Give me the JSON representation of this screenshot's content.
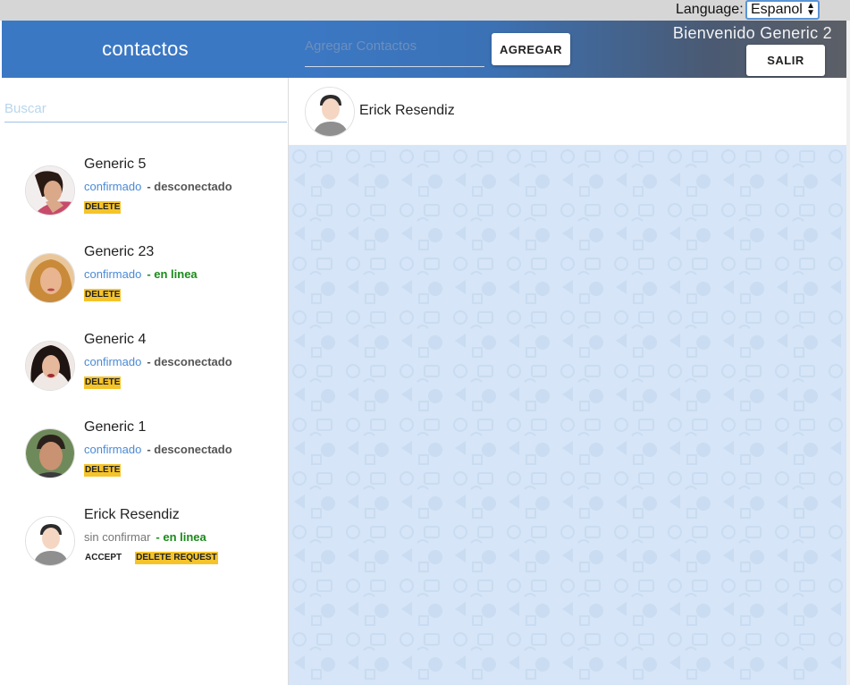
{
  "language": {
    "label": "Language:",
    "selected": "Espanol"
  },
  "header": {
    "app_title": "contactos",
    "add_contact_placeholder": "Agregar Contactos",
    "add_button": "AGREGAR",
    "welcome": "Bienvenido Generic 2",
    "logout_button": "SALIR"
  },
  "sidebar": {
    "search_placeholder": "Buscar",
    "contacts": [
      {
        "name": "Generic 5",
        "status": "confirmado",
        "presence": "- desconectado",
        "delete_label": "DELETE",
        "avatar": "woman-dark-hair"
      },
      {
        "name": "Generic 23",
        "status": "confirmado",
        "presence": "- en linea",
        "delete_label": "DELETE",
        "avatar": "woman-blonde"
      },
      {
        "name": "Generic 4",
        "status": "confirmado",
        "presence": "- desconectado",
        "delete_label": "DELETE",
        "avatar": "woman-curly-hair"
      },
      {
        "name": "Generic 1",
        "status": "confirmado",
        "presence": "- desconectado",
        "delete_label": "DELETE",
        "avatar": "man-portrait"
      },
      {
        "name": "Erick Resendiz",
        "status": "sin confirmar",
        "presence": "- en linea",
        "accept_label": "ACCEPT",
        "delete_request_label": "DELETE REQUEST",
        "avatar": "default-user"
      }
    ]
  },
  "chat": {
    "contact_name": "Erick Resendiz",
    "avatar": "default-user"
  },
  "colors": {
    "accent": "#3b78c4",
    "confirmed": "#4a8ad6",
    "online": "#1b8a1b",
    "tag": "#f5c42a",
    "chat_bg": "#d6e5f7"
  }
}
